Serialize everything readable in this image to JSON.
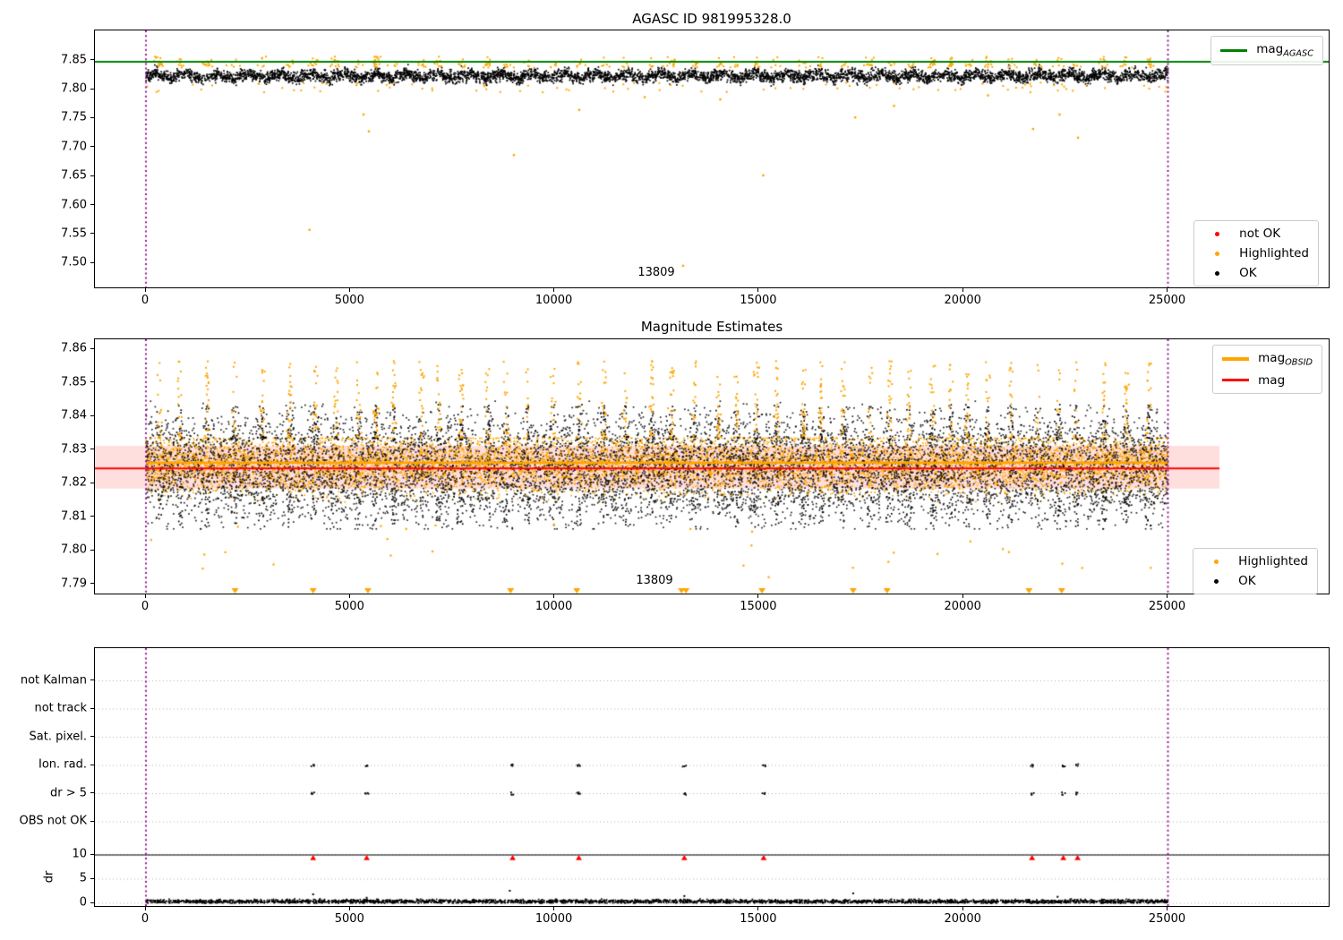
{
  "colors": {
    "black": "#000000",
    "orange": "#FFA500",
    "red": "#FF0000",
    "green": "#008000",
    "purple": "#8B008B",
    "grid": "#b0b0b0",
    "band": "rgba(255,0,0,0.13)"
  },
  "plots": {
    "top": {
      "title": "AGASC ID 981995328.0",
      "line_legend": {
        "main": "mag",
        "sub": "AGASC"
      },
      "marker_legend": [
        {
          "label": "not OK",
          "color": "red"
        },
        {
          "label": "Highlighted",
          "color": "orange"
        },
        {
          "label": "OK",
          "color": "black"
        }
      ]
    },
    "middle": {
      "title": "Magnitude Estimates",
      "line_legend": [
        {
          "main": "mag",
          "sub": "OBSID",
          "color": "orange"
        },
        {
          "main": "mag",
          "sub": "",
          "color": "red"
        }
      ],
      "marker_legend": [
        {
          "label": "Highlighted",
          "color": "orange"
        },
        {
          "label": "OK",
          "color": "black"
        }
      ]
    }
  },
  "chart_data": [
    {
      "id": "top-magnitude-history",
      "type": "scatter",
      "title": "AGASC ID 981995328.0",
      "xlim": [
        -1250,
        28980
      ],
      "ylim": [
        7.4556,
        7.9021
      ],
      "x_ticks": [
        0,
        5000,
        10000,
        15000,
        20000,
        25000
      ],
      "x_tick_labels": [
        "0",
        "5000",
        "10000",
        "15000",
        "20000",
        "25000"
      ],
      "y_tick_vals": [
        7.85,
        7.8,
        7.75,
        7.7,
        7.65,
        7.6,
        7.55,
        7.5
      ],
      "y_tick_labels": [
        "7.85",
        "7.80",
        "7.75",
        "7.70",
        "7.65",
        "7.60",
        "7.55",
        "7.50"
      ],
      "hline": {
        "label": "mag_AGASC",
        "value": 7.848,
        "color": "green"
      },
      "vlines": {
        "x": [
          0,
          25000
        ],
        "color": "purple",
        "style": "dotted"
      },
      "series": [
        {
          "name": "OK",
          "color": "black",
          "cloud": {
            "n": 5500,
            "x_range": [
              0,
              25000
            ],
            "y_center": 7.8235,
            "y_sd": 0.0048,
            "y_clip": [
              7.806,
              7.8445
            ]
          }
        },
        {
          "name": "Highlighted",
          "color": "orange",
          "above_band_y_range": [
            7.8425,
            7.857
          ],
          "below_band": {
            "n": 90,
            "y_range": [
              7.795,
              7.812
            ]
          },
          "outliers": [
            [
              4000,
              7.558
            ],
            [
              5322,
              7.757
            ],
            [
              5454,
              7.728
            ],
            [
              9000,
              7.687
            ],
            [
              10600,
              7.765
            ],
            [
              12200,
              7.787
            ],
            [
              13140,
              7.496
            ],
            [
              14050,
              7.783
            ],
            [
              15100,
              7.652
            ],
            [
              17350,
              7.752
            ],
            [
              18300,
              7.772
            ],
            [
              20600,
              7.79
            ],
            [
              21700,
              7.732
            ],
            [
              22350,
              7.757
            ],
            [
              22800,
              7.717
            ]
          ]
        },
        {
          "name": "not OK",
          "color": "red",
          "points": []
        }
      ],
      "annotation": {
        "text": "13809",
        "x": 12450,
        "y": 7.502
      }
    },
    {
      "id": "magnitude-estimates",
      "type": "scatter",
      "title": "Magnitude Estimates",
      "xlim": [
        -1250,
        28980
      ],
      "ylim": [
        7.7867,
        7.8629
      ],
      "x_ticks": [
        0,
        5000,
        10000,
        15000,
        20000,
        25000
      ],
      "x_tick_labels": [
        "0",
        "5000",
        "10000",
        "15000",
        "20000",
        "25000"
      ],
      "y_tick_vals": [
        7.86,
        7.85,
        7.84,
        7.83,
        7.82,
        7.81,
        7.8,
        7.79
      ],
      "y_tick_labels": [
        "7.86",
        "7.85",
        "7.84",
        "7.83",
        "7.82",
        "7.81",
        "7.80",
        "7.79"
      ],
      "band": {
        "y_range": [
          7.8185,
          7.8312
        ],
        "color": "band"
      },
      "hlines": [
        {
          "label": "mag_OBSID",
          "value": 7.8262,
          "color": "orange"
        },
        {
          "label": "mag",
          "value": 7.8245,
          "color": "red"
        }
      ],
      "vlines": {
        "x": [
          0,
          25000
        ],
        "color": "purple",
        "style": "dotted"
      },
      "series": [
        {
          "name": "OK",
          "color": "black",
          "cloud": {
            "n": 8500,
            "x_range": [
              0,
              25000
            ],
            "y_center": 7.8245,
            "y_sd": 0.0075,
            "y_clip": [
              7.8065,
              7.8445
            ]
          },
          "spike_y_range": [
            7.833,
            7.8435
          ]
        },
        {
          "name": "Highlighted",
          "color": "orange",
          "cloud": {
            "n": 7000,
            "x_range": [
              0,
              25000
            ],
            "y_center": 7.8257,
            "y_sd": 0.0042,
            "y_clip": [
              7.8145,
              7.8335
            ]
          },
          "spike_y_range": [
            7.8335,
            7.8565
          ],
          "low_outliers": {
            "n": 28,
            "y_range": [
              7.792,
              7.808
            ]
          }
        }
      ],
      "clipped_low_x": [
        2180,
        4090,
        5430,
        8920,
        10540,
        13100,
        13210,
        15070,
        17300,
        18130,
        21600,
        22400
      ],
      "annotation": {
        "text": "13809",
        "x": 12450,
        "y": 7.7925
      }
    },
    {
      "id": "flags-and-dr",
      "type": "scatter",
      "categories": [
        "not Kalman",
        "not track",
        "Sat. pixel.",
        "Ion. rad.",
        "dr > 5",
        "OBS not OK"
      ],
      "flag_rows_with_points": [
        "Ion. rad.",
        "dr > 5"
      ],
      "flag_x": [
        4090,
        5400,
        8970,
        10590,
        13170,
        15110,
        21675,
        22440,
        22790
      ],
      "dr_axis": {
        "label": "dr",
        "ticks": [
          10,
          5,
          0
        ],
        "tick_labels": [
          "10",
          "5",
          "0"
        ],
        "hline": 10
      },
      "dr_red_x": [
        4090,
        5400,
        8970,
        10590,
        13170,
        15110,
        21675,
        22440,
        22790
      ],
      "dr_red_y": 9.4,
      "dr_cloud": {
        "n": 3200,
        "x_range": [
          0,
          25000
        ],
        "center": 0.38,
        "sd": 0.2,
        "clip": [
          0.04,
          1.3
        ]
      },
      "dr_extra_points": [
        [
          8900,
          2.6
        ],
        [
          17300,
          2.05
        ],
        [
          4090,
          1.85
        ],
        [
          13170,
          1.5
        ],
        [
          22300,
          1.35
        ],
        [
          5400,
          1.15
        ]
      ],
      "vlines": {
        "x": [
          0,
          25000
        ],
        "color": "purple",
        "style": "dotted"
      },
      "x_ticks": [
        0,
        5000,
        10000,
        15000,
        20000,
        25000
      ],
      "x_tick_labels": [
        "0",
        "5000",
        "10000",
        "15000",
        "20000",
        "25000"
      ]
    }
  ]
}
